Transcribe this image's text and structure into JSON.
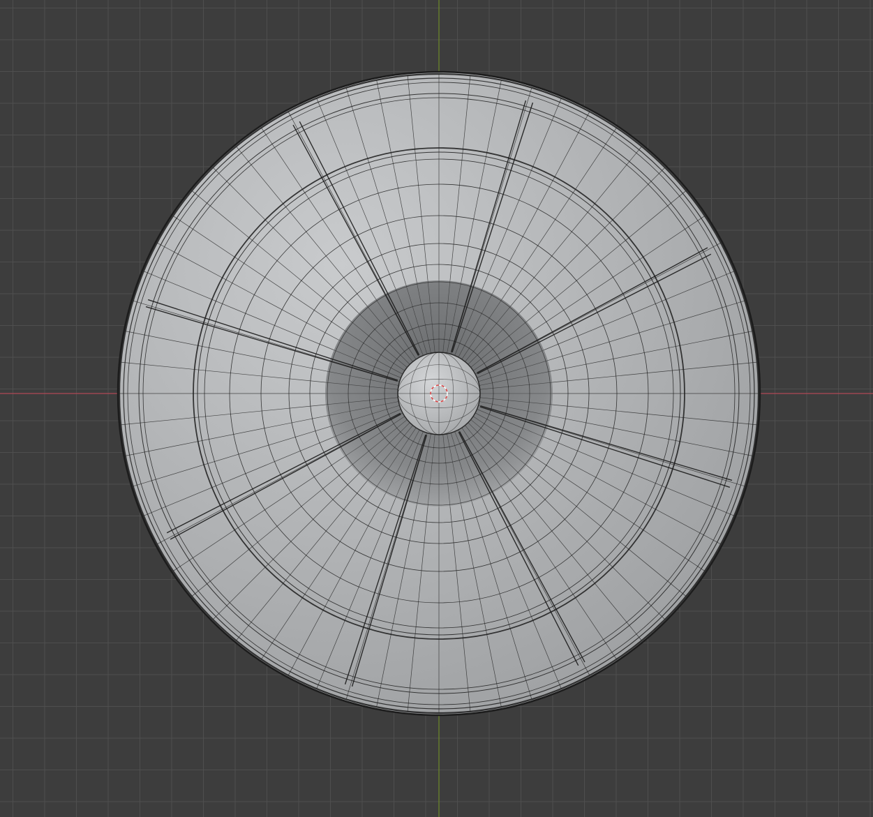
{
  "viewport": {
    "background_color": "#3d3d3d",
    "grid_line_color": "#505050",
    "x_axis_color": "#b04a55",
    "y_axis_color": "#6f8a2a"
  },
  "mesh": {
    "shape": "dish with central boss",
    "body_color_light": "#c9cbcd",
    "body_color_dark": "#9a9c9e",
    "wire_color": "#1c1c1c",
    "hub_color": "#bdbfc1",
    "recess_color": "#7b7d7f",
    "spoke_count": 8,
    "radial_edge_count": 64
  },
  "origin_marker": {
    "icon": "3d-cursor-icon",
    "ring_color_a": "#e04040",
    "ring_color_b": "#ffffff"
  }
}
